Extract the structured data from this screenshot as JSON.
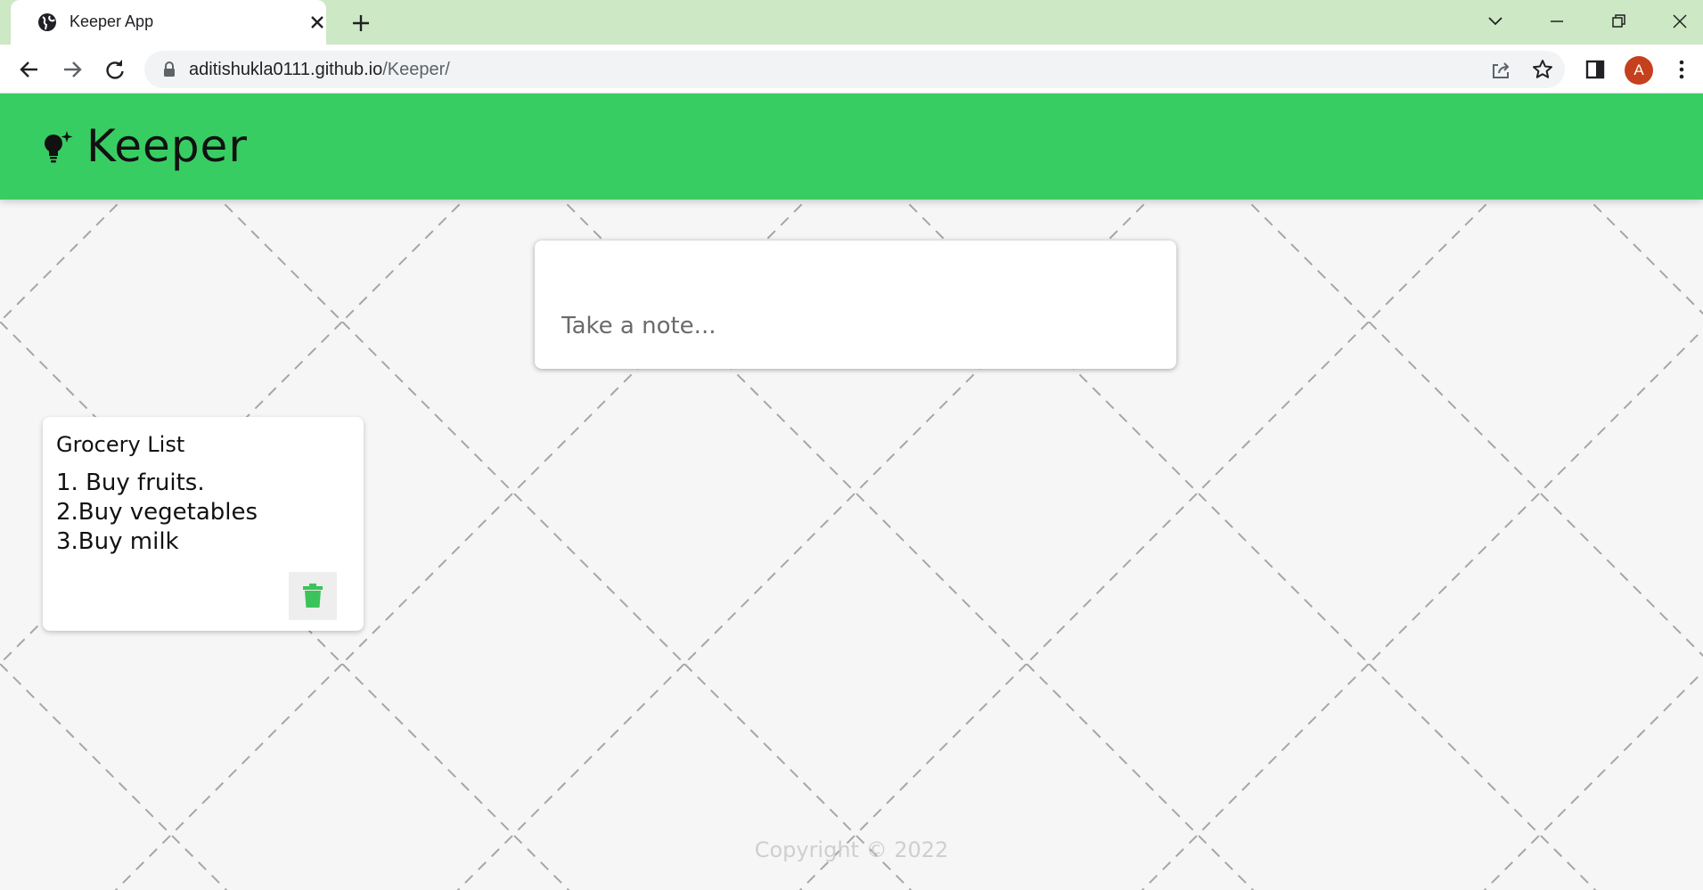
{
  "browser": {
    "tab_title": "Keeper App",
    "url_host": "aditishukla0111.github.io",
    "url_path": "/Keeper/",
    "profile_initial": "A",
    "profile_color": "#c5401d",
    "icons": [
      "globe-icon",
      "close-icon",
      "plus-icon",
      "chevron-down-icon",
      "minimize-icon",
      "restore-icon",
      "window-close-icon",
      "back-arrow-icon",
      "forward-arrow-icon",
      "reload-icon",
      "lock-icon",
      "share-icon",
      "star-icon",
      "side-panel-icon",
      "kebab-menu-icon"
    ]
  },
  "app": {
    "brand": "Keeper",
    "header_color": "#38cd63",
    "accent_color": "#3cc45a",
    "logo_icon": "lightbulb-sparkle-icon"
  },
  "create_note": {
    "placeholder": "Take a note..."
  },
  "notes": [
    {
      "title": "Grocery List",
      "lines": [
        "1. Buy fruits.",
        "2.Buy vegetables",
        "3.Buy milk"
      ],
      "delete_icon": "trash-icon"
    }
  ],
  "footer": {
    "text": "Copyright © 2022"
  }
}
